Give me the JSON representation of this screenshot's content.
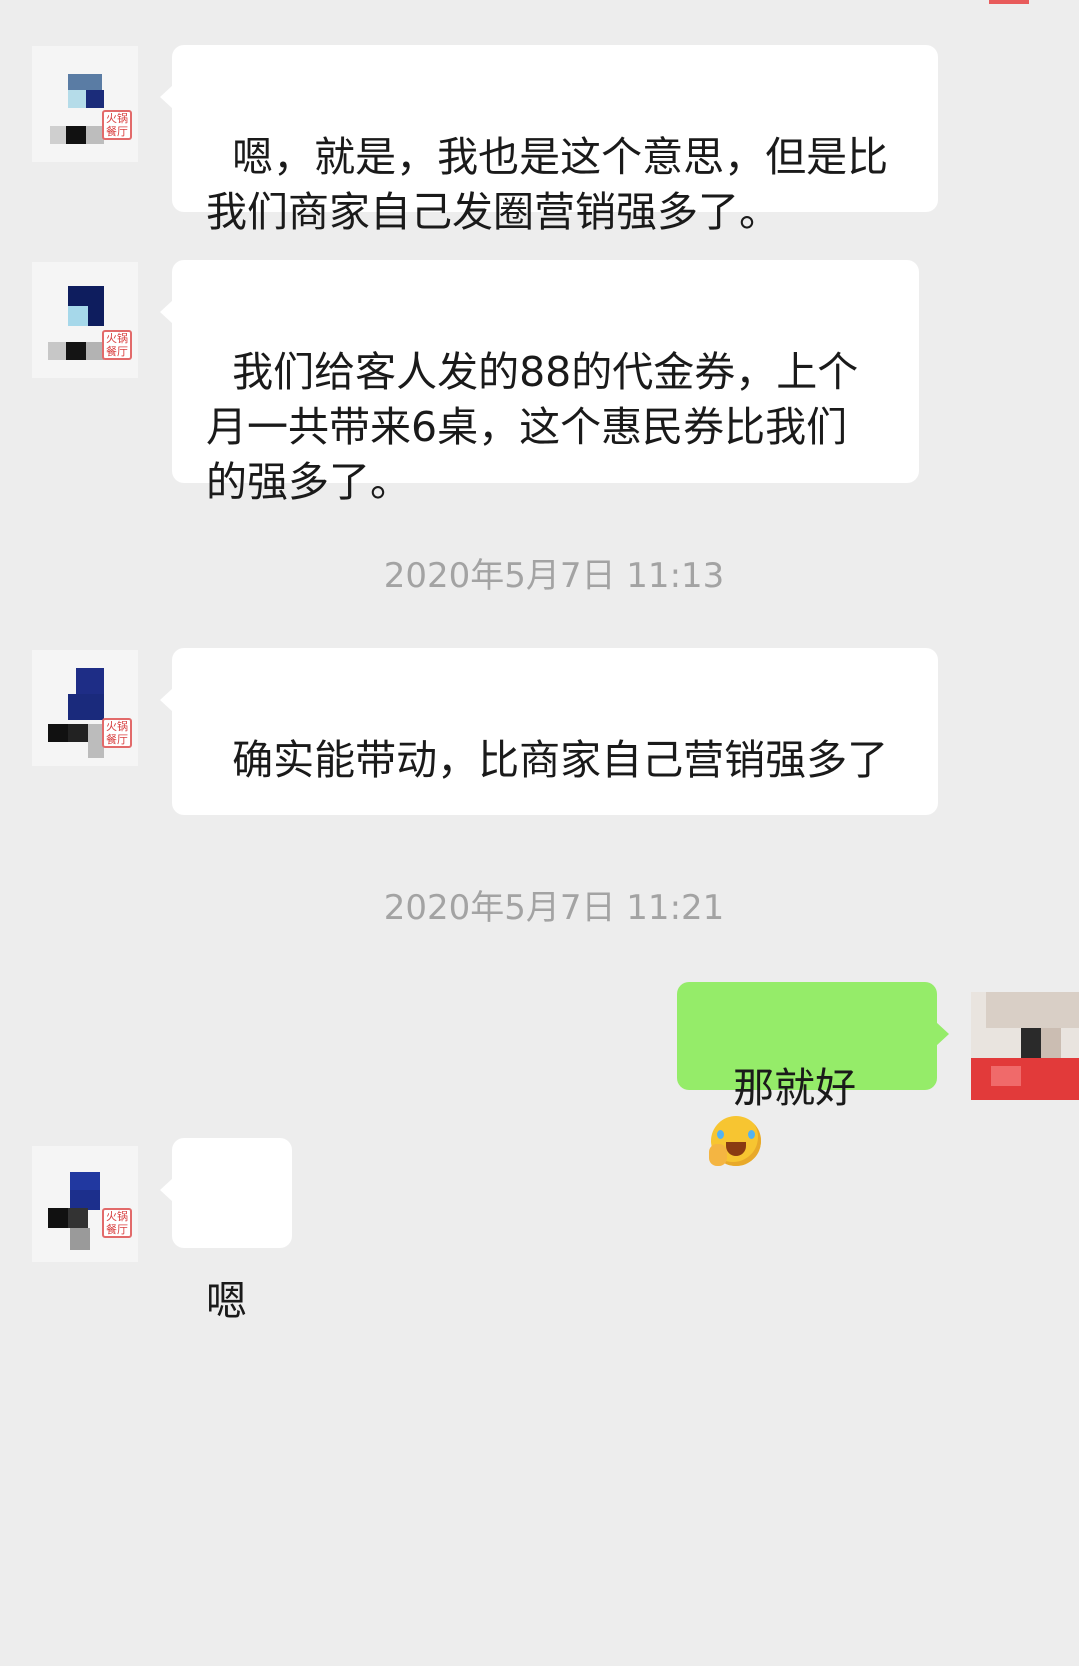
{
  "chat": {
    "messages": [
      {
        "side": "left",
        "text": "嗯，就是，我也是这个意思，但是比我们商家自己发圈营销强多了。"
      },
      {
        "side": "left",
        "text": "我们给客人发的88的代金券，上个月一共带来6桌，这个惠民券比我们的强多了。"
      },
      {
        "side": "left",
        "text": "确实能带动，比商家自己营销强多了"
      },
      {
        "side": "right",
        "text": "那就好",
        "emoji": "facepalm-laughing-emoji"
      },
      {
        "side": "left",
        "text": "嗯"
      }
    ],
    "timestamps": [
      "2020年5月7日 11:13",
      "2020年5月7日 11:21"
    ],
    "avatar_stamp_text": "火锅餐厅"
  },
  "colors": {
    "background": "#ededed",
    "incoming_bubble": "#ffffff",
    "outgoing_bubble": "#95ec69",
    "timestamp_text": "#a3a3a3"
  }
}
